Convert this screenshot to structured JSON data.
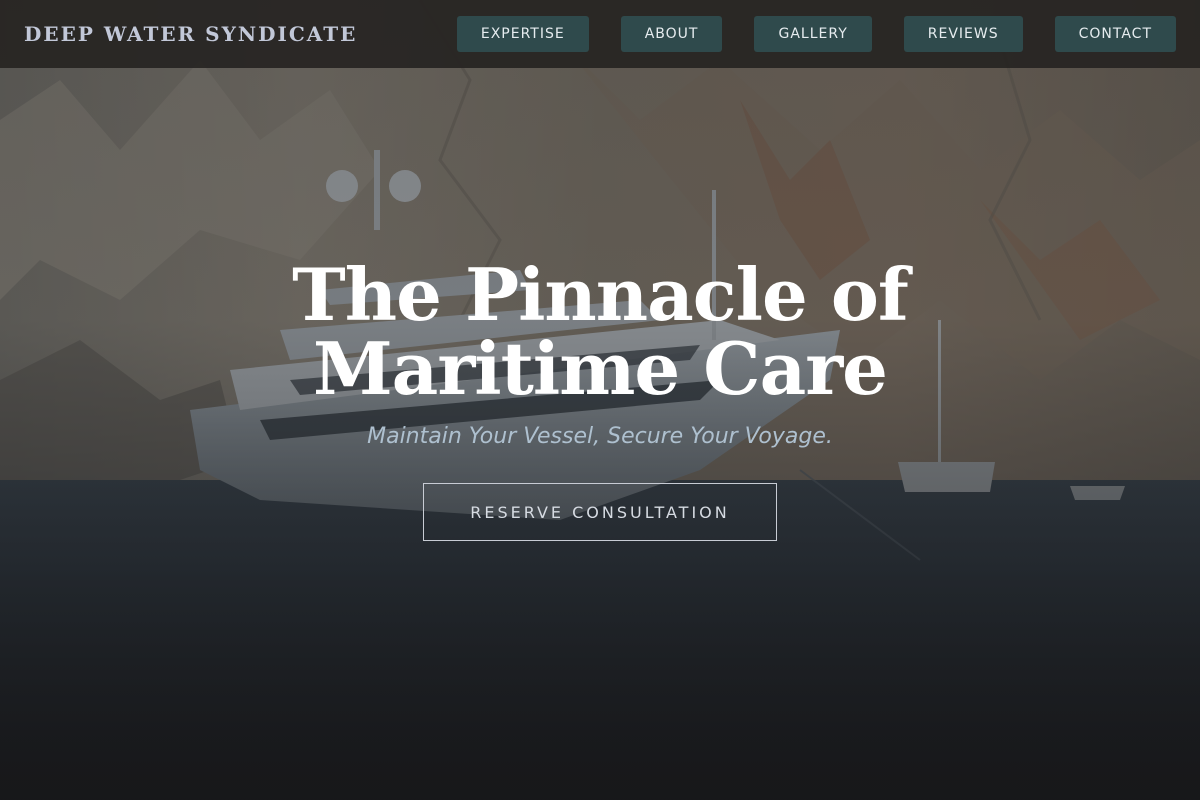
{
  "header": {
    "brand": "DEEP WATER SYNDICATE",
    "nav": [
      {
        "label": "EXPERTISE"
      },
      {
        "label": "ABOUT"
      },
      {
        "label": "GALLERY"
      },
      {
        "label": "REVIEWS"
      },
      {
        "label": "CONTACT"
      }
    ]
  },
  "hero": {
    "title": "The Pinnacle of Maritime Care",
    "subtitle": "Maintain Your Vessel, Secure Your Voyage.",
    "cta_label": "RESERVE CONSULTATION"
  },
  "colors": {
    "nav_bg": "#262422",
    "nav_button": "#2f4a4c",
    "brand_text": "#c2c8d8",
    "subtitle_text": "#aec0cf"
  }
}
